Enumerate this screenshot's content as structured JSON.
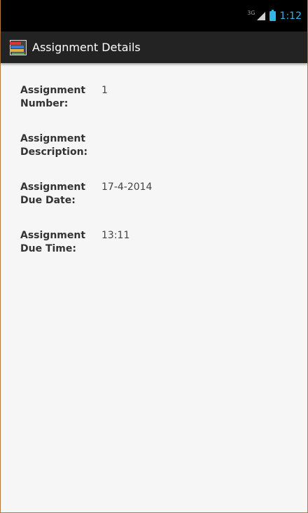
{
  "status_bar": {
    "network_type": "3G",
    "time": "1:12",
    "icons": [
      "signal-icon",
      "battery-icon"
    ]
  },
  "action_bar": {
    "title": "Assignment Details",
    "icon": "books-app-icon"
  },
  "details": [
    {
      "label": "Assignment Number:",
      "value": "1"
    },
    {
      "label": "Assignment Description:",
      "value": ""
    },
    {
      "label": "Assignment Due Date:",
      "value": "17-4-2014"
    },
    {
      "label": "Assignment Due Time:",
      "value": "13:11"
    }
  ],
  "colors": {
    "status_accent": "#33b5e5",
    "action_bar_bg": "#232323",
    "content_bg": "#f6f6f6"
  }
}
